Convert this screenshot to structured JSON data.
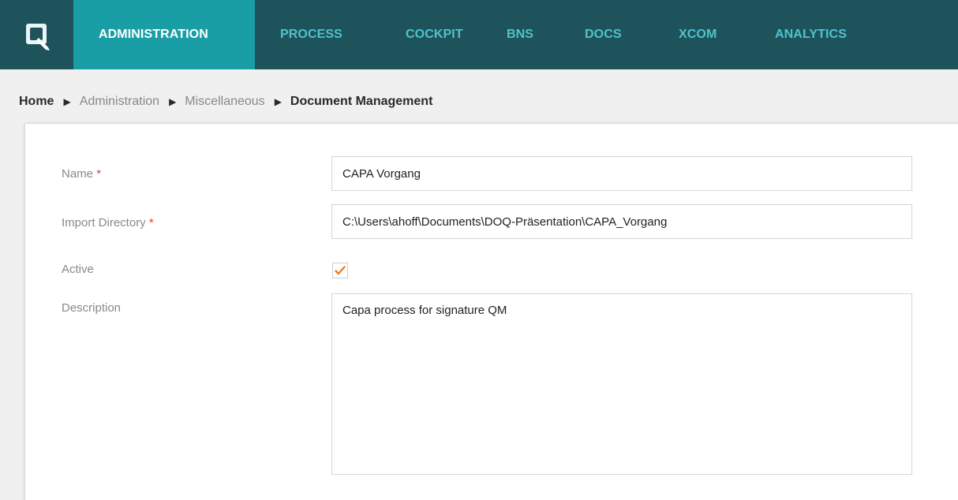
{
  "colors": {
    "topbar": "#1f535c",
    "active_tab": "#1a9ea6",
    "nav_text": "#4ec3cb",
    "checkmark": "#f07c1f",
    "required": "#e23b3b"
  },
  "logo": {
    "icon": "app-logo-icon"
  },
  "nav": {
    "items": [
      {
        "label": "ADMINISTRATION",
        "active": true
      },
      {
        "label": "PROCESS",
        "active": false
      },
      {
        "label": "COCKPIT",
        "active": false
      },
      {
        "label": "BNS",
        "active": false
      },
      {
        "label": "DOCS",
        "active": false
      },
      {
        "label": "XCOM",
        "active": false
      },
      {
        "label": "ANALYTICS",
        "active": false
      }
    ]
  },
  "breadcrumb": {
    "home": "Home",
    "items": [
      "Administration",
      "Miscellaneous"
    ],
    "current": "Document Management",
    "separator_icon": "triangle-right-icon"
  },
  "form": {
    "name": {
      "label": "Name",
      "required_mark": "*",
      "value": "CAPA Vorgang"
    },
    "import_directory": {
      "label": "Import Directory",
      "required_mark": "*",
      "value": "C:\\Users\\ahoff\\Documents\\DOQ-Präsentation\\CAPA_Vorgang"
    },
    "active": {
      "label": "Active",
      "checked": true,
      "icon": "checkmark-icon"
    },
    "description": {
      "label": "Description",
      "value": "Capa process for signature QM"
    }
  }
}
